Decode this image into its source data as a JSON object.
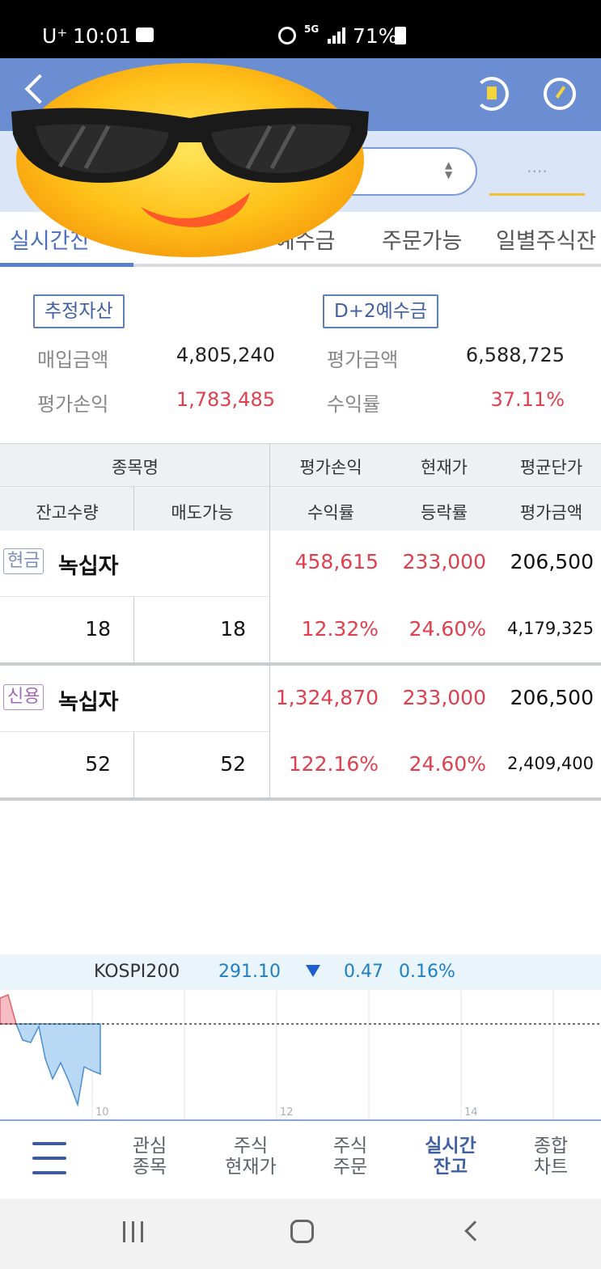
{
  "status_bar": {
    "carrier": "U⁺",
    "time": "10:01",
    "network": "5G",
    "battery": "71%"
  },
  "header": {
    "back_icon": "chevron-left-icon",
    "actions": [
      "refresh-icon",
      "gauge-icon"
    ]
  },
  "account": {
    "password_placeholder": "····"
  },
  "tabs": {
    "items": [
      {
        "label": "실시간잔고",
        "active": true
      },
      {
        "label": "예수금",
        "active": false
      },
      {
        "label": "주문가능",
        "active": false
      },
      {
        "label": "일별주식잔",
        "active": false
      }
    ],
    "active_visible": "실시간잔",
    "second_visible": "예수금"
  },
  "summary": {
    "badge_left": "추정자산",
    "badge_right": "D+2예수금",
    "purchase_label": "매입금액",
    "purchase_value": "4,805,240",
    "eval_amount_label": "평가금액",
    "eval_amount_value": "6,588,725",
    "eval_pl_label": "평가손익",
    "eval_pl_value": "1,783,485",
    "return_label": "수익률",
    "return_value": "37.11%"
  },
  "table": {
    "headers": {
      "stock_name": "종목명",
      "eval_pl": "평가손익",
      "current_price": "현재가",
      "avg_price": "평균단가",
      "balance_qty": "잔고수량",
      "sellable": "매도가능",
      "return_rate": "수익률",
      "change_rate": "등락률",
      "eval_amount": "평가금액"
    },
    "rows": [
      {
        "type": "현금",
        "name": "녹십자",
        "eval_pl": "458,615",
        "current_price": "233,000",
        "avg_price": "206,500",
        "balance_qty": "18",
        "sellable": "18",
        "return_rate": "12.32%",
        "change_rate": "24.60%",
        "eval_amount": "4,179,325"
      },
      {
        "type": "신용",
        "name": "녹십자",
        "eval_pl": "1,324,870",
        "current_price": "233,000",
        "avg_price": "206,500",
        "balance_qty": "52",
        "sellable": "52",
        "return_rate": "122.16%",
        "change_rate": "24.60%",
        "eval_amount": "2,409,400"
      }
    ]
  },
  "index_ticker": {
    "name": "KOSPI200",
    "value": "291.10",
    "direction": "down",
    "change": "0.47",
    "change_pct": "0.16%",
    "axis_labels": [
      "10",
      "12",
      "14"
    ]
  },
  "bottom_nav": {
    "menu_icon": "hamburger-menu-icon",
    "items": [
      {
        "line1": "관심",
        "line2": "종목",
        "active": false
      },
      {
        "line1": "주식",
        "line2": "현재가",
        "active": false
      },
      {
        "line1": "주식",
        "line2": "주문",
        "active": false
      },
      {
        "line1": "실시간",
        "line2": "잔고",
        "active": true
      },
      {
        "line1": "종합",
        "line2": "차트",
        "active": false
      }
    ]
  },
  "colors": {
    "header_blue": "#6a8ed1",
    "positive_red": "#e0404e",
    "index_blue": "#1e7fc4",
    "accent_yellow": "#f2c12e"
  }
}
